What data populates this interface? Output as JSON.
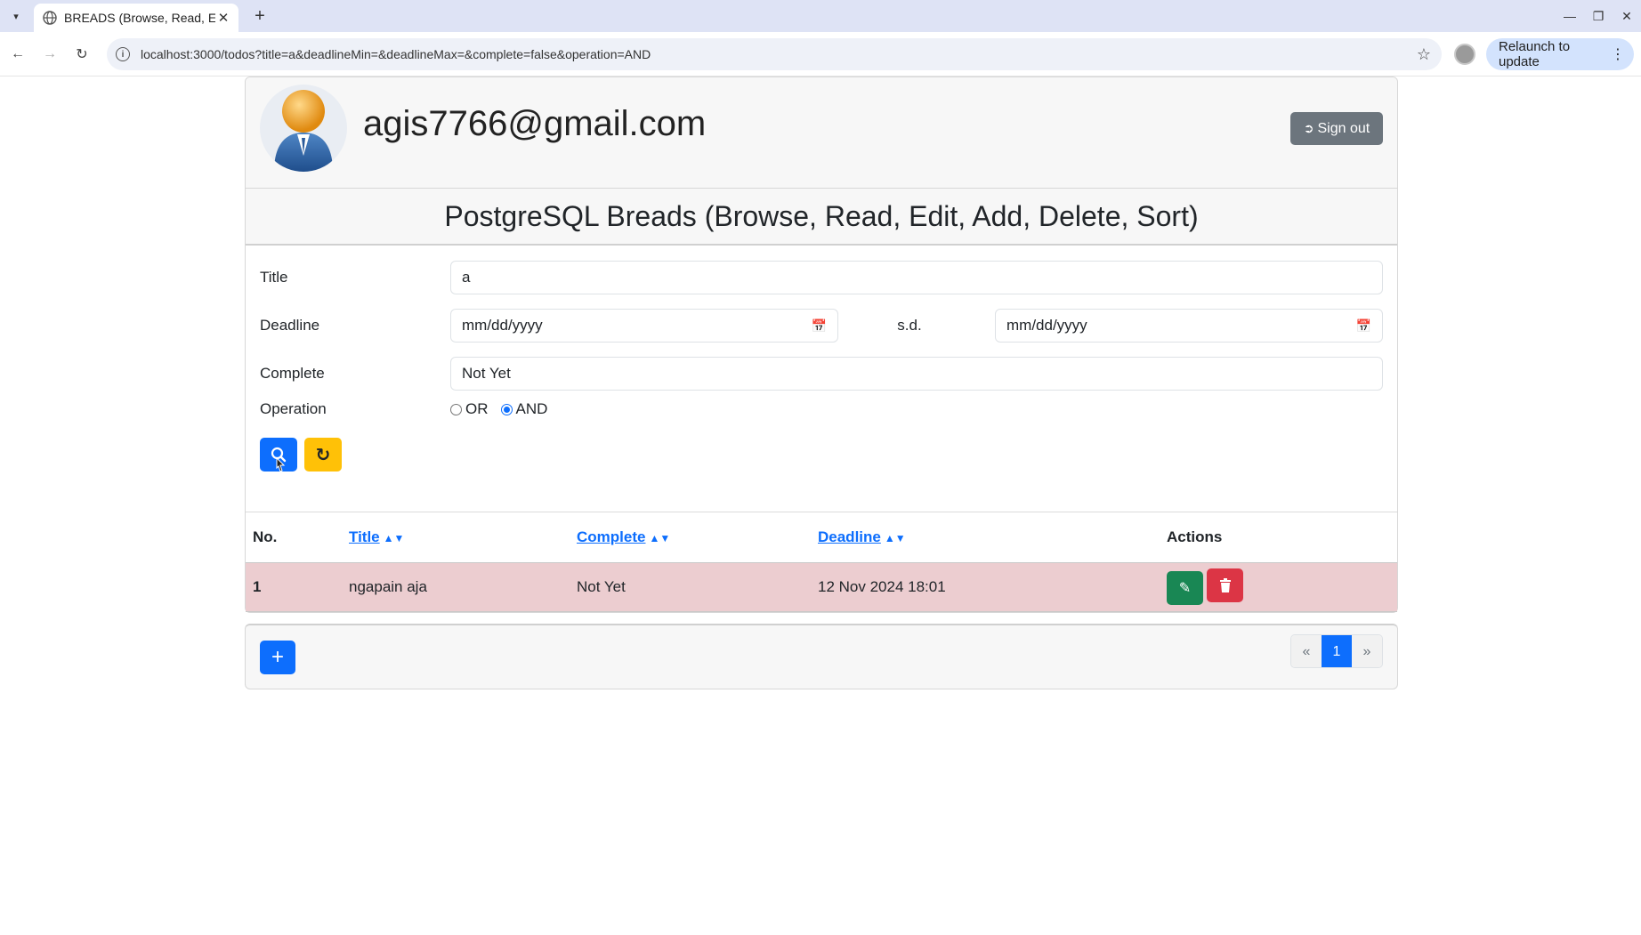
{
  "browser": {
    "tab_title": "BREADS (Browse, Read, Edit, Add, Delete, Sort)",
    "url": "localhost:3000/todos?title=a&deadlineMin=&deadlineMax=&complete=false&operation=AND",
    "relaunch_label": "Relaunch to update"
  },
  "header": {
    "email": "agis7766@gmail.com",
    "signout_label": "Sign out"
  },
  "page_title": "PostgreSQL Breads (Browse, Read, Edit, Add, Delete, Sort)",
  "filters": {
    "title_label": "Title",
    "title_value": "a",
    "deadline_label": "Deadline",
    "deadline_min_placeholder": "mm/dd/yyyy",
    "sd_label": "s.d.",
    "deadline_max_placeholder": "mm/dd/yyyy",
    "complete_label": "Complete",
    "complete_value": "Not Yet",
    "operation_label": "Operation",
    "operation_or": "OR",
    "operation_and": "AND",
    "operation_selected": "AND"
  },
  "table": {
    "headers": {
      "no": "No.",
      "title": "Title",
      "complete": "Complete",
      "deadline": "Deadline",
      "actions": "Actions"
    },
    "rows": [
      {
        "no": "1",
        "title": "ngapain aja",
        "complete": "Not Yet",
        "deadline": "12 Nov 2024 18:01"
      }
    ]
  },
  "pagination": {
    "prev": "«",
    "current": "1",
    "next": "»"
  },
  "colors": {
    "primary": "#0d6efd",
    "warning": "#ffc107",
    "success": "#198754",
    "danger": "#dc3545",
    "secondary": "#6c757d",
    "row_highlight": "#eccdd0"
  }
}
